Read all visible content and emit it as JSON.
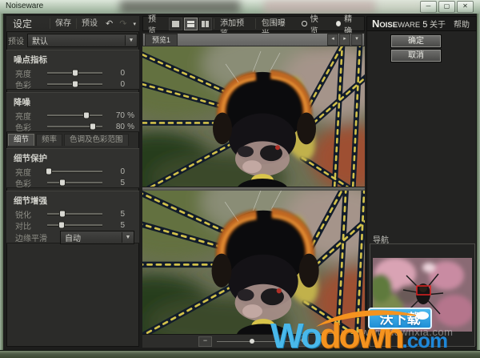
{
  "window": {
    "title": "Noiseware",
    "minimize": "─",
    "maximize": "▢",
    "close": "✕"
  },
  "settings_toolbar": {
    "title": "设定",
    "save": "保存",
    "preset": "预设",
    "undo": "↶",
    "redo": "↷",
    "more": "▾"
  },
  "preset": {
    "label": "预设",
    "value": "默认",
    "arrow": "▼"
  },
  "sections": {
    "noise_level": {
      "title": "噪点指标",
      "rows": [
        {
          "label": "亮度",
          "value": "0",
          "unit": "",
          "pos": 50
        },
        {
          "label": "色彩",
          "value": "0",
          "unit": "",
          "pos": 50
        }
      ]
    },
    "noise_reduction": {
      "title": "降噪",
      "rows": [
        {
          "label": "亮度",
          "value": "70",
          "unit": "%",
          "pos": 71
        },
        {
          "label": "色彩",
          "value": "80",
          "unit": "%",
          "pos": 82
        }
      ]
    },
    "detail_protection": {
      "title": "细节保护",
      "rows": [
        {
          "label": "亮度",
          "value": "0",
          "unit": "",
          "pos": 3
        },
        {
          "label": "色彩",
          "value": "5",
          "unit": "",
          "pos": 27
        }
      ]
    },
    "detail_enhancement": {
      "title": "细节增强",
      "rows": [
        {
          "label": "锐化",
          "value": "5",
          "unit": "",
          "pos": 27
        },
        {
          "label": "对比",
          "value": "5",
          "unit": "",
          "pos": 26
        }
      ],
      "edge": {
        "label": "边缘平滑",
        "value": "自动",
        "arrow": "▼"
      }
    }
  },
  "detail_tabs": [
    {
      "label": "细节"
    },
    {
      "label": "频率"
    },
    {
      "label": "色调及色彩范围"
    }
  ],
  "preview_toolbar": {
    "title": "预览",
    "add_view": "添加预览",
    "bracketing": "包围曝光",
    "quick": "快览",
    "precise": "精确"
  },
  "preview_tabs": {
    "tab1": "预览1",
    "prev": "◂",
    "next": "▸",
    "more": "▾"
  },
  "zoom_control": {
    "minus": "−",
    "plus": "+"
  },
  "brand_bar": {
    "n1": "N",
    "n2": "OISE",
    "n3": "WARE",
    "version": "5",
    "about": "关于",
    "help": "帮助"
  },
  "actions": {
    "ok": "确定",
    "cancel": "取消"
  },
  "navigator": {
    "title": "导航"
  },
  "watermark": {
    "badge": "沃下载",
    "url": "www.downxia.com",
    "wo": "Wo",
    "down": "down",
    "com": ".com"
  },
  "colors": {
    "accent_blue": "#49b8ea",
    "accent_orange": "#f5931f",
    "badge_blue": "#2aa0e0",
    "nav_view_box_red": "#e02020"
  }
}
